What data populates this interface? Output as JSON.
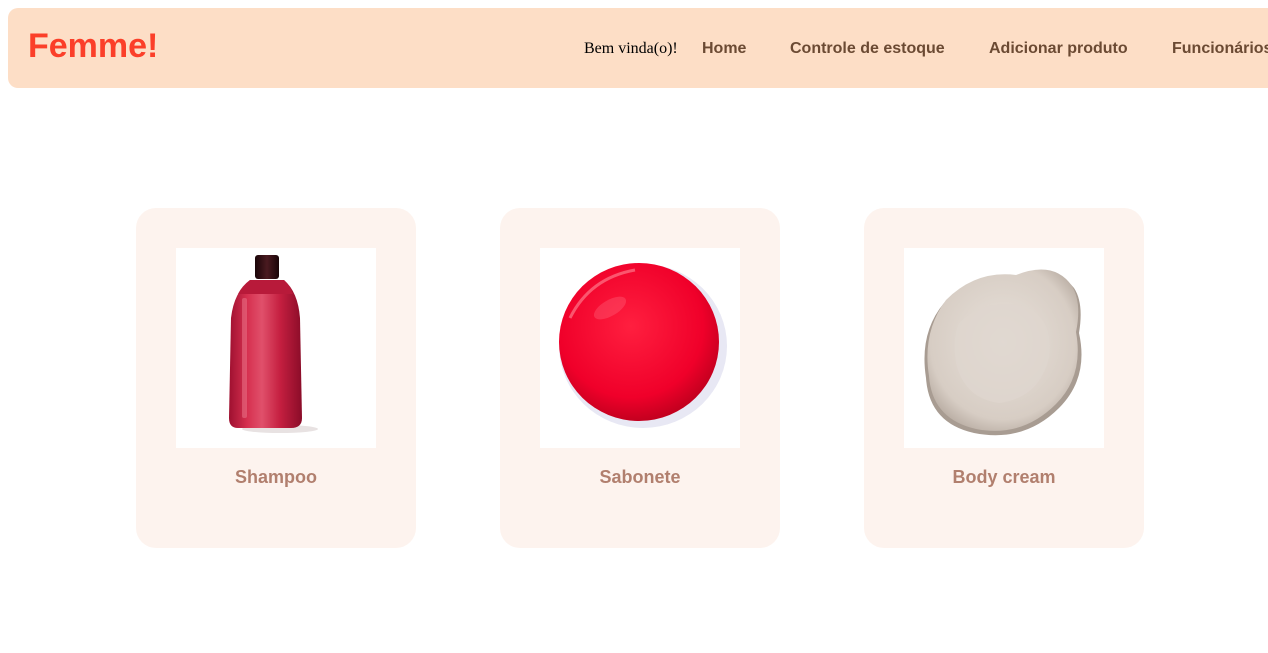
{
  "header": {
    "logo": "Femme!",
    "welcome": "Bem vinda(o)!",
    "nav": [
      {
        "label": "Home"
      },
      {
        "label": "Controle de estoque"
      },
      {
        "label": "Adicionar produto"
      },
      {
        "label": "Funcionários"
      }
    ]
  },
  "products": [
    {
      "name": "Shampoo",
      "image": "shampoo-bottle-image"
    },
    {
      "name": "Sabonete",
      "image": "red-soap-image"
    },
    {
      "name": "Body cream",
      "image": "body-cream-swatch-image"
    }
  ],
  "colors": {
    "header_bg": "#fddec6",
    "logo": "#fb3f29",
    "nav_link": "#6b4a33",
    "card_bg": "#fdf3ee",
    "card_label": "#b17f6e"
  }
}
